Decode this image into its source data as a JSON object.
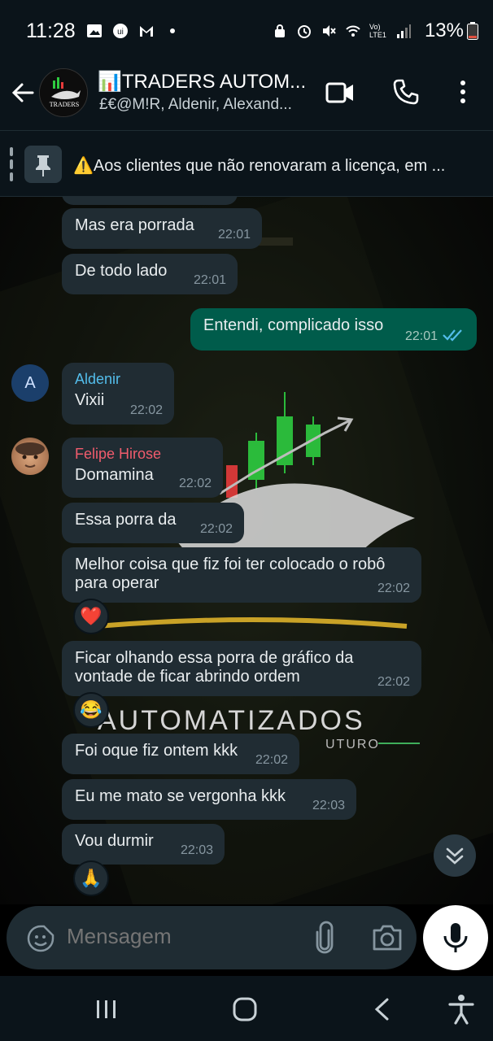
{
  "status_bar": {
    "time": "11:28",
    "network_label": "Vo) LTE1",
    "battery": "13%",
    "icons": [
      "gallery-icon",
      "app-icon",
      "gmail-icon",
      "dot-icon",
      "app-lock-icon",
      "alarm-icon",
      "mute-icon",
      "wifi-icon",
      "signal-icon",
      "battery-icon"
    ]
  },
  "header": {
    "title": "📊TRADERS AUTOM...",
    "subtitle": "£€@M!R, Aldenir, Alexand...",
    "avatar_text": "TRADERS"
  },
  "pinned": {
    "text": "⚠️Aos clientes que não renovaram a licença, em ..."
  },
  "messages": [
    {
      "text": "Mas era porrada",
      "time": "22:01",
      "direction": "in"
    },
    {
      "text": "De todo lado",
      "time": "22:01",
      "direction": "in"
    },
    {
      "text": "Entendi, complicado isso",
      "time": "22:01",
      "direction": "out",
      "status": "read"
    },
    {
      "sender": "Aldenir",
      "sender_color": "#53bdeb",
      "text": "Vixii",
      "time": "22:02",
      "direction": "in"
    },
    {
      "sender": "Felipe Hirose",
      "sender_color": "#f15c6d",
      "text": "Domamina",
      "time": "22:02",
      "direction": "in"
    },
    {
      "text": "Essa porra da",
      "time": "22:02",
      "direction": "in"
    },
    {
      "text_line1": "Melhor coisa que fiz foi ter colocado o robô",
      "text_line2": "para operar",
      "time": "22:02",
      "direction": "in",
      "reaction": "❤️"
    },
    {
      "text_line1": "Ficar olhando essa porra de gráfico da",
      "text_line2": "vontade de ficar abrindo ordem",
      "time": "22:02",
      "direction": "in",
      "reaction": "😂"
    },
    {
      "text": "Foi oque fiz ontem kkk",
      "time": "22:02",
      "direction": "in"
    },
    {
      "text": "Eu me mato se vergonha kkk",
      "time": "22:03",
      "direction": "in"
    },
    {
      "text": "Vou durmir",
      "time": "22:03",
      "direction": "in",
      "reaction": "🙏"
    }
  ],
  "avatars": {
    "aldenir_initial": "A"
  },
  "wallpaper": {
    "brand_line1": "AUTOMATIZADOS",
    "brand_line2": "UTURO"
  },
  "input": {
    "placeholder": "Mensagem"
  },
  "colors": {
    "incoming_bubble": "#202c33",
    "outgoing_bubble": "#005c4b",
    "read_ticks": "#53bdeb",
    "app_bg": "#0b141a"
  }
}
